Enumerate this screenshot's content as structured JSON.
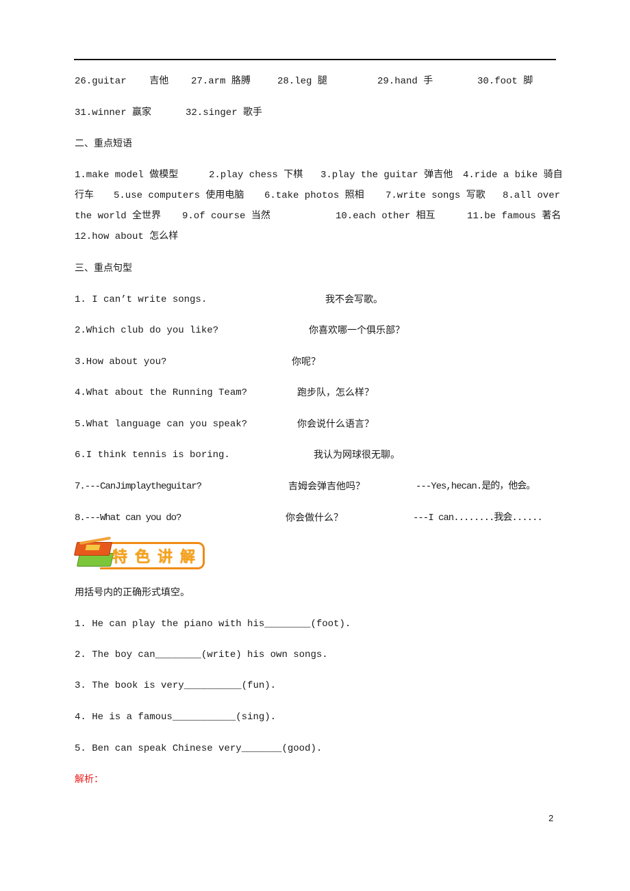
{
  "vocab": {
    "items": [
      {
        "en": "26.guitar",
        "zh": "吉他"
      },
      {
        "en": "27.arm",
        "zh": "胳膊"
      },
      {
        "en": "28.leg",
        "zh": "腿"
      },
      {
        "en": "29.hand",
        "zh": "手"
      },
      {
        "en": "30.foot",
        "zh": "脚"
      },
      {
        "en": "31.winner",
        "zh": "赢家"
      },
      {
        "en": "32.singer",
        "zh": "歌手"
      }
    ]
  },
  "phrases": {
    "heading": "二、重点短语",
    "lines": [
      "1.make model 做模型 2.play chess 下棋 3.play the guitar 弹吉他 4.ride a bike 骑自",
      "行车 5.use computers 使用电脑 6.take photos 照相 7.write songs 写歌 8.all over",
      "the world 全世界 9.of course 当然 10.each other 相互 11.be famous 著名",
      "12.how about 怎么样"
    ],
    "segments": [
      [
        "1.make model 做模型",
        "2.play chess 下棋",
        "3.play the guitar 弹吉他",
        "4.ride a bike 骑自"
      ],
      [
        "行车",
        "5.use computers 使用电脑",
        "6.take photos 照相",
        "7.write songs 写歌",
        "8.all over"
      ],
      [
        "the world 全世界",
        "9.of course 当然",
        "10.each other 相互",
        "11.be famous 著名"
      ],
      [
        "12.how about 怎么样"
      ]
    ]
  },
  "sentences": {
    "heading": "三、重点句型",
    "items": [
      {
        "en": "1. I can’t write songs.",
        "zh": "我不会写歌。"
      },
      {
        "en": "2.Which club do you like?",
        "zh": "你喜欢哪一个俱乐部？"
      },
      {
        "en": "3.How about you?",
        "zh": "你呢？"
      },
      {
        "en": "4.What about the Running Team?",
        "zh": "跑步队，怎么样？"
      },
      {
        "en": "5.What language can you speak?",
        "zh": "你会说什么语言？"
      },
      {
        "en": "6.I think tennis is boring.",
        "zh": "我认为网球很无聊。"
      },
      {
        "en": "7.---CanJimplaytheguitar?",
        "zh": "吉姆会弹吉他吗？",
        "reply": "---Yes,hecan.是的，他会。"
      },
      {
        "en": "8.---What can you do?",
        "zh": "你会做什么？",
        "reply": "---I can........我会......"
      }
    ]
  },
  "banner": {
    "title": "特色讲解",
    "icon": "books-icon"
  },
  "exercise": {
    "instruction": "用括号内的正确形式填空。",
    "items": [
      "1. He can play the piano with his________(foot).",
      "2. The boy can________(write) his own songs.",
      "3. The book is very__________(fun).",
      "4. He is a famous___________(sing).",
      "5. Ben can speak Chinese very_______(good)."
    ]
  },
  "analysis_label": "解析：",
  "page_number": "2"
}
